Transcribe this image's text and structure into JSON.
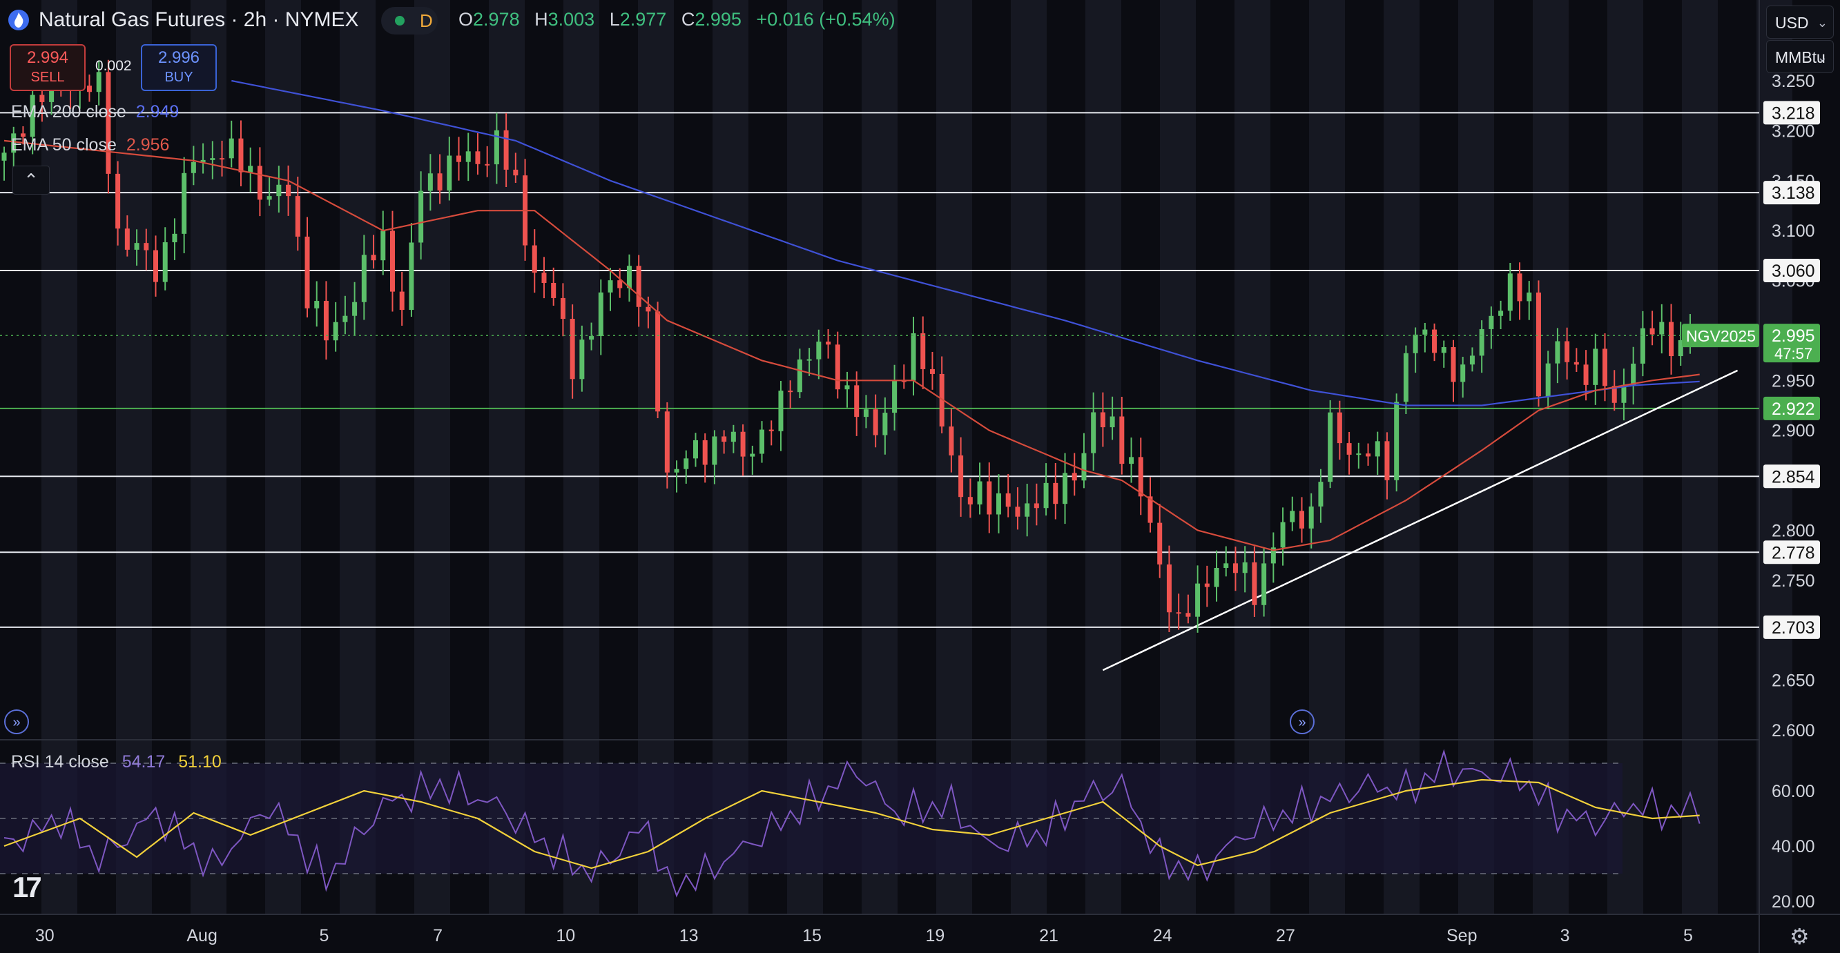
{
  "header": {
    "symbol_title": "Natural Gas Futures · 2h · NYMEX",
    "session_badge": "D",
    "ohlc": [
      {
        "k": "O",
        "v": "2.978"
      },
      {
        "k": "H",
        "v": "3.003"
      },
      {
        "k": "L",
        "v": "2.977"
      },
      {
        "k": "C",
        "v": "2.995"
      }
    ],
    "change": "+0.016 (+0.54%)"
  },
  "trade": {
    "sell_price": "2.994",
    "sell_label": "SELL",
    "buy_price": "2.996",
    "buy_label": "BUY",
    "spread": "0.002"
  },
  "indicators": {
    "ema200_label": "EMA 200 close",
    "ema200_value": "2.949",
    "ema50_label": "EMA 50 close",
    "ema50_value": "2.956",
    "rsi_label": "RSI 14 close",
    "rsi_value": "54.17",
    "rsi_ma_value": "51.10",
    "collapse_icon": "chevron-up-icon"
  },
  "price_scale": {
    "currency": "USD",
    "unit": "MMBtu",
    "current_symbol": "NGV2025",
    "current_price": "2.995",
    "countdown": "47:57"
  },
  "colors": {
    "up": "#26a69a",
    "up_body": "#5cbf6a",
    "down": "#ef5350",
    "ema200": "#3f51d6",
    "ema50": "#d64b3c",
    "rsi": "#7e57c2",
    "rsi_ma": "#f2d13b",
    "level_highlight": "#4caf50",
    "background": "#0b0c12"
  },
  "chart_data": [
    {
      "type": "candlestick",
      "title": "Natural Gas Futures · 2h · NYMEX",
      "ylim": [
        2.6,
        3.25
      ],
      "y_ticks": [
        "3.250",
        "3.200",
        "3.150",
        "3.100",
        "3.050",
        "3.000",
        "2.950",
        "2.900",
        "2.850",
        "2.800",
        "2.750",
        "2.700",
        "2.650",
        "2.600"
      ],
      "x_tick_labels": [
        "30",
        "Aug",
        "5",
        "7",
        "10",
        "13",
        "15",
        "19",
        "21",
        "24",
        "27",
        "Sep",
        "3",
        "5"
      ],
      "x_tick_index": [
        4,
        20,
        34,
        46,
        59,
        72,
        85,
        98,
        110,
        122,
        135,
        153,
        165,
        178
      ],
      "x_count": 185,
      "horizontal_levels": [
        {
          "value": 3.218,
          "label": "3.218"
        },
        {
          "value": 3.138,
          "label": "3.138"
        },
        {
          "value": 3.06,
          "label": "3.060"
        },
        {
          "value": 2.922,
          "label": "2.922",
          "highlight": true
        },
        {
          "value": 2.854,
          "label": "2.854"
        },
        {
          "value": 2.778,
          "label": "2.778"
        },
        {
          "value": 2.703,
          "label": "2.703"
        }
      ],
      "trendline": {
        "from": [
          116,
          2.66
        ],
        "to": [
          183,
          2.96
        ]
      },
      "close_anchors": [
        [
          0,
          3.17
        ],
        [
          3,
          3.23
        ],
        [
          6,
          3.25
        ],
        [
          10,
          3.24
        ],
        [
          12,
          3.1
        ],
        [
          14,
          3.08
        ],
        [
          16,
          3.06
        ],
        [
          18,
          3.11
        ],
        [
          20,
          3.17
        ],
        [
          23,
          3.18
        ],
        [
          26,
          3.16
        ],
        [
          28,
          3.13
        ],
        [
          30,
          3.14
        ],
        [
          32,
          3.04
        ],
        [
          34,
          2.99
        ],
        [
          36,
          3.02
        ],
        [
          38,
          3.06
        ],
        [
          40,
          3.09
        ],
        [
          42,
          3.02
        ],
        [
          44,
          3.14
        ],
        [
          46,
          3.16
        ],
        [
          48,
          3.17
        ],
        [
          50,
          3.17
        ],
        [
          52,
          3.19
        ],
        [
          54,
          3.14
        ],
        [
          56,
          3.06
        ],
        [
          58,
          3.03
        ],
        [
          60,
          2.97
        ],
        [
          62,
          3.0
        ],
        [
          64,
          3.05
        ],
        [
          66,
          3.06
        ],
        [
          68,
          3.0
        ],
        [
          70,
          2.86
        ],
        [
          72,
          2.87
        ],
        [
          74,
          2.88
        ],
        [
          76,
          2.9
        ],
        [
          78,
          2.87
        ],
        [
          80,
          2.9
        ],
        [
          82,
          2.92
        ],
        [
          84,
          2.97
        ],
        [
          86,
          2.99
        ],
        [
          88,
          2.95
        ],
        [
          90,
          2.93
        ],
        [
          92,
          2.89
        ],
        [
          94,
          2.95
        ],
        [
          96,
          2.98
        ],
        [
          98,
          2.95
        ],
        [
          100,
          2.88
        ],
        [
          101,
          2.82
        ],
        [
          103,
          2.84
        ],
        [
          105,
          2.83
        ],
        [
          107,
          2.81
        ],
        [
          109,
          2.84
        ],
        [
          111,
          2.83
        ],
        [
          113,
          2.86
        ],
        [
          115,
          2.91
        ],
        [
          117,
          2.9
        ],
        [
          119,
          2.87
        ],
        [
          121,
          2.8
        ],
        [
          122,
          2.76
        ],
        [
          124,
          2.71
        ],
        [
          126,
          2.73
        ],
        [
          128,
          2.77
        ],
        [
          130,
          2.76
        ],
        [
          132,
          2.74
        ],
        [
          134,
          2.79
        ],
        [
          136,
          2.81
        ],
        [
          138,
          2.82
        ],
        [
          140,
          2.9
        ],
        [
          142,
          2.88
        ],
        [
          144,
          2.88
        ],
        [
          146,
          2.86
        ],
        [
          148,
          2.99
        ],
        [
          150,
          2.99
        ],
        [
          152,
          2.98
        ],
        [
          154,
          2.95
        ],
        [
          156,
          3.0
        ],
        [
          157,
          3.02
        ],
        [
          159,
          3.04
        ],
        [
          161,
          3.03
        ],
        [
          162,
          2.95
        ],
        [
          164,
          2.98
        ],
        [
          166,
          2.96
        ],
        [
          168,
          2.97
        ],
        [
          170,
          2.92
        ],
        [
          172,
          2.98
        ],
        [
          174,
          3.0
        ],
        [
          176,
          2.99
        ],
        [
          179,
          2.995
        ]
      ],
      "ema50_anchors": [
        [
          0,
          3.19
        ],
        [
          20,
          3.17
        ],
        [
          30,
          3.15
        ],
        [
          40,
          3.1
        ],
        [
          50,
          3.12
        ],
        [
          56,
          3.12
        ],
        [
          64,
          3.06
        ],
        [
          70,
          3.01
        ],
        [
          80,
          2.97
        ],
        [
          88,
          2.95
        ],
        [
          96,
          2.95
        ],
        [
          104,
          2.9
        ],
        [
          114,
          2.86
        ],
        [
          118,
          2.85
        ],
        [
          126,
          2.8
        ],
        [
          134,
          2.78
        ],
        [
          140,
          2.79
        ],
        [
          148,
          2.83
        ],
        [
          156,
          2.88
        ],
        [
          162,
          2.92
        ],
        [
          168,
          2.94
        ],
        [
          174,
          2.95
        ],
        [
          179,
          2.956
        ]
      ],
      "ema200_anchors": [
        [
          24,
          3.25
        ],
        [
          40,
          3.22
        ],
        [
          54,
          3.19
        ],
        [
          64,
          3.15
        ],
        [
          76,
          3.11
        ],
        [
          88,
          3.07
        ],
        [
          100,
          3.04
        ],
        [
          112,
          3.01
        ],
        [
          126,
          2.97
        ],
        [
          138,
          2.94
        ],
        [
          148,
          2.925
        ],
        [
          156,
          2.925
        ],
        [
          164,
          2.935
        ],
        [
          172,
          2.945
        ],
        [
          179,
          2.949
        ]
      ]
    },
    {
      "type": "line",
      "title": "RSI 14 close",
      "ylim": [
        15,
        75
      ],
      "y_ticks": [
        "60.00",
        "40.00",
        "20.00"
      ],
      "bands": [
        70,
        50,
        30
      ],
      "series": [
        {
          "name": "RSI",
          "anchors": [
            [
              0,
              40
            ],
            [
              6,
              50
            ],
            [
              10,
              35
            ],
            [
              16,
              52
            ],
            [
              22,
              32
            ],
            [
              28,
              55
            ],
            [
              34,
              28
            ],
            [
              40,
              55
            ],
            [
              46,
              62
            ],
            [
              52,
              55
            ],
            [
              58,
              38
            ],
            [
              62,
              30
            ],
            [
              68,
              48
            ],
            [
              70,
              25
            ],
            [
              74,
              30
            ],
            [
              80,
              44
            ],
            [
              86,
              58
            ],
            [
              90,
              68
            ],
            [
              94,
              52
            ],
            [
              100,
              55
            ],
            [
              104,
              40
            ],
            [
              110,
              45
            ],
            [
              114,
              58
            ],
            [
              118,
              62
            ],
            [
              122,
              35
            ],
            [
              126,
              30
            ],
            [
              130,
              42
            ],
            [
              134,
              50
            ],
            [
              138,
              55
            ],
            [
              144,
              62
            ],
            [
              148,
              60
            ],
            [
              152,
              68
            ],
            [
              156,
              66
            ],
            [
              160,
              65
            ],
            [
              164,
              52
            ],
            [
              168,
              48
            ],
            [
              172,
              55
            ],
            [
              176,
              52
            ],
            [
              179,
              54.17
            ]
          ]
        },
        {
          "name": "RSI MA",
          "anchors": [
            [
              0,
              40
            ],
            [
              8,
              50
            ],
            [
              14,
              36
            ],
            [
              20,
              52
            ],
            [
              26,
              44
            ],
            [
              32,
              52
            ],
            [
              38,
              60
            ],
            [
              44,
              56
            ],
            [
              50,
              50
            ],
            [
              56,
              38
            ],
            [
              62,
              32
            ],
            [
              68,
              38
            ],
            [
              74,
              50
            ],
            [
              80,
              60
            ],
            [
              86,
              56
            ],
            [
              92,
              52
            ],
            [
              98,
              46
            ],
            [
              104,
              44
            ],
            [
              110,
              50
            ],
            [
              116,
              56
            ],
            [
              122,
              40
            ],
            [
              126,
              33
            ],
            [
              132,
              38
            ],
            [
              140,
              52
            ],
            [
              148,
              60
            ],
            [
              156,
              64
            ],
            [
              162,
              63
            ],
            [
              168,
              54
            ],
            [
              174,
              50
            ],
            [
              179,
              51.1
            ]
          ]
        }
      ]
    }
  ]
}
